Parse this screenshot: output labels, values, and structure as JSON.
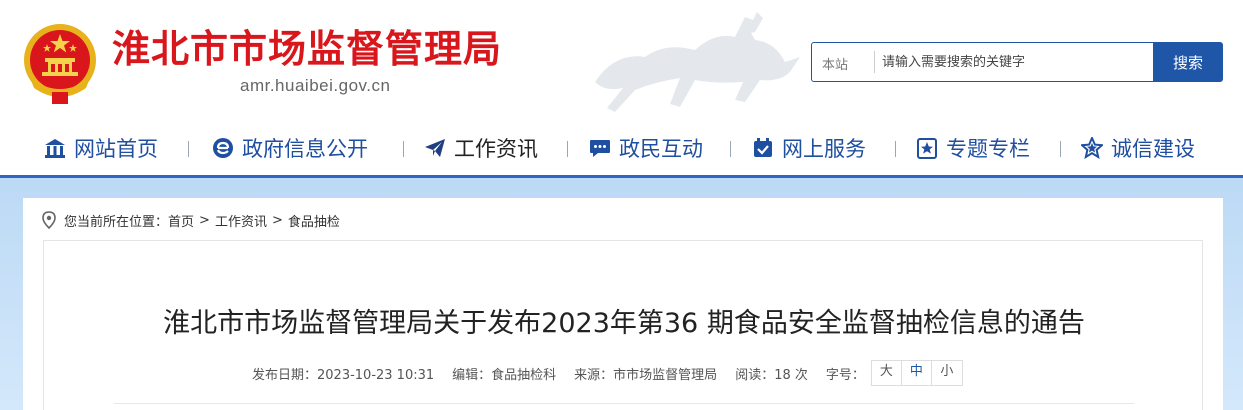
{
  "header": {
    "site_title": "淮北市市场监督管理局",
    "domain": "amr.huaibei.gov.cn",
    "emblem_icon": "national-emblem-icon",
    "brand_red": "#d8161b",
    "brand_blue": "#1f56a8"
  },
  "search": {
    "scope_label": "本站",
    "placeholder": "请输入需要搜索的关键字",
    "button_label": "搜索"
  },
  "nav": {
    "items": [
      {
        "label": "网站首页",
        "icon": "home-icon"
      },
      {
        "label": "政府信息公开",
        "icon": "e-gov-icon"
      },
      {
        "label": "工作资讯",
        "icon": "paper-plane-icon",
        "active": true
      },
      {
        "label": "政民互动",
        "icon": "chat-bubble-icon"
      },
      {
        "label": "网上服务",
        "icon": "calendar-check-icon"
      },
      {
        "label": "专题专栏",
        "icon": "bookmark-icon"
      },
      {
        "label": "诚信建设",
        "icon": "star-icon"
      }
    ]
  },
  "breadcrumb": {
    "prefix": "您当前所在位置：",
    "items": [
      "首页",
      "工作资讯",
      "食品抽检"
    ],
    "separator": ">"
  },
  "article": {
    "title": "淮北市市场监督管理局关于发布2023年第36 期食品安全监督抽检信息的通告",
    "publish_date": "发布日期：2023-10-23 10:31",
    "editor": "编辑：食品抽检科",
    "source": "来源：市市场监督管理局",
    "reads": "阅读：18 次",
    "font_size_label": "字号：",
    "font_sizes": [
      "大",
      "中",
      "小"
    ],
    "selected_font_size": "中"
  }
}
